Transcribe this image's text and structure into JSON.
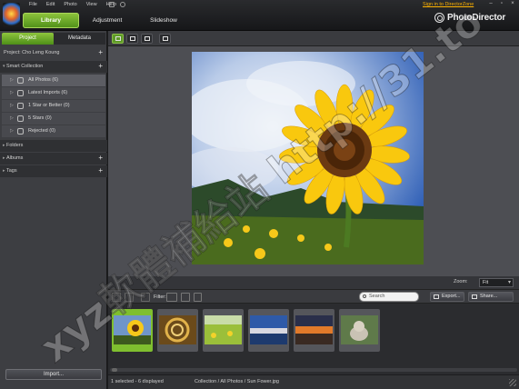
{
  "menu": [
    "File",
    "Edit",
    "Photo",
    "View",
    "Help"
  ],
  "mode_tabs": [
    "Library",
    "Adjustment",
    "Slideshow"
  ],
  "signin": "Sign in to DirectorZone",
  "brand": "PhotoDirector",
  "panel_tabs": [
    "Project",
    "Metadata"
  ],
  "project": "Project: Cho Leng Koung",
  "smart_collection": "Smart Collection",
  "collections": [
    "All Photos (6)",
    "Latest Imports (6)",
    "1 Star or Better (0)",
    "5 Stars (0)",
    "Rejected (0)"
  ],
  "folders": "Folders",
  "albums": "Albums",
  "tags": "Tags",
  "import_label": "Import...",
  "zoom": {
    "label": "Zoom:",
    "value": "Fit"
  },
  "filter_label": "Filter:",
  "search_placeholder": "Search",
  "export_label": "Export...",
  "share_label": "Share...",
  "status": {
    "selection": "1 selected - 6 displayed",
    "path": "Collection / All Photos / Sun Fower.jpg"
  },
  "watermark": "xyz軟體補給站 http://31.to",
  "colors": {
    "accent": "#6bab23",
    "signin": "#ffb400"
  }
}
